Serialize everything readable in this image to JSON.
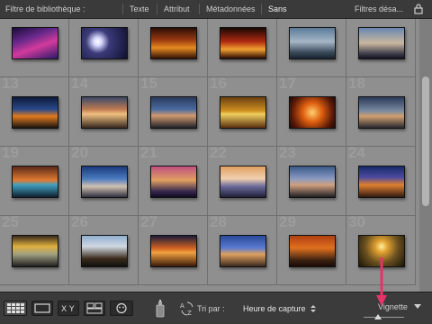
{
  "filter_bar": {
    "title": "Filtre de bibliothèque :",
    "tabs": [
      "Texte",
      "Attribut",
      "Métadonnées",
      "Sans"
    ],
    "active_tab": "Sans",
    "preset_label": "Filtres désa..."
  },
  "grid": {
    "numbers": [
      "",
      "",
      "",
      "",
      "",
      "",
      "13",
      "14",
      "15",
      "16",
      "17",
      "18",
      "19",
      "20",
      "21",
      "22",
      "23",
      "24",
      "25",
      "26",
      "27",
      "28",
      "29",
      "30"
    ],
    "thumbs": [
      {
        "gradient": "linear-gradient(160deg,#1a0b3a 0%,#6a2a8c 35%,#d23a9c 60%,#2a1a6a 100%)"
      },
      {
        "gradient": "radial-gradient(circle at 35% 45%,#ffffff 0%,#d8d8ff 12%,#3b3b7a 35%,#101030 100%)"
      },
      {
        "gradient": "linear-gradient(180deg,#2a0e06 0%,#9c3a10 40%,#e68a20 65%,#301005 100%)"
      },
      {
        "gradient": "linear-gradient(180deg,#1a0805 0%,#b02a10 45%,#f0a030 70%,#2a0a05 100%)"
      },
      {
        "gradient": "linear-gradient(180deg,#5a7a9a 0%,#a6b6c6 45%,#3a4a5a 80%,#1a2430 100%)"
      },
      {
        "gradient": "linear-gradient(180deg,#6a86b0 0%,#c9b8a0 50%,#3a3a48 85%,#141420 100%)"
      },
      {
        "gradient": "linear-gradient(180deg,#0d1a3a 0%,#2a4a8a 40%,#e07a20 62%,#1a1410 100%)"
      },
      {
        "gradient": "linear-gradient(180deg,#3a4a6a 0%,#c07a50 40%,#f0c080 55%,#3a2a20 100%)"
      },
      {
        "gradient": "linear-gradient(180deg,#2a3a5a 0%,#4a6aa0 40%,#d09a70 60%,#22222a 100%)"
      },
      {
        "gradient": "linear-gradient(180deg,#6a4010 0%,#d09020 45%,#f0d060 55%,#5a3010 100%)"
      },
      {
        "gradient": "radial-gradient(circle at 50% 50%,#ffd070 0%,#e06010 35%,#5a1a08 75%,#200805 100%)"
      },
      {
        "gradient": "linear-gradient(180deg,#2a3a5a 0%,#7a8aa0 45%,#d0a070 62%,#2a2a30 100%)"
      },
      {
        "gradient": "linear-gradient(180deg,#5a2a1a 0%,#e07a30 45%,#40a0c0 60%,#102030 100%)"
      },
      {
        "gradient": "linear-gradient(180deg,#1a3a7a 0%,#4a7ac0 40%,#d0c0b0 65%,#303040 100%)"
      },
      {
        "gradient": "linear-gradient(180deg,#c05080 0%,#e0a060 45%,#3a2a50 80%,#100a20 100%)"
      },
      {
        "gradient": "linear-gradient(180deg,#e0a060 0%,#f0d0b0 40%,#6a6a9a 65%,#20203a 100%)"
      },
      {
        "gradient": "linear-gradient(180deg,#3a5a8a 0%,#8a9ac0 40%,#d0a080 60%,#202024 100%)"
      },
      {
        "gradient": "linear-gradient(180deg,#1a2a6a 0%,#4a4aa0 35%,#e08030 60%,#301a10 100%)"
      },
      {
        "gradient": "linear-gradient(180deg,#3a2a1a 0%,#e0b040 35%,#a0a080 60%,#202020 100%)"
      },
      {
        "gradient": "linear-gradient(180deg,#90b0d0 0%,#d0d8e0 35%,#3a2a1a 75%,#101010 100%)"
      },
      {
        "gradient": "linear-gradient(180deg,#1a1a3a 0%,#d06020 40%,#f0a040 55%,#3a1a0a 100%)"
      },
      {
        "gradient": "linear-gradient(180deg,#2a4a9a 0%,#5a7ad0 40%,#e0a060 60%,#3a2a20 100%)"
      },
      {
        "gradient": "linear-gradient(180deg,#b04010 0%,#e07020 40%,#3a2010 80%,#1a0a05 100%)"
      },
      {
        "gradient": "radial-gradient(circle at 50% 35%,#fff0a0 0%,#e0a030 20%,#6a5020 55%,#1a1408 100%)"
      }
    ]
  },
  "toolbar": {
    "sort_label": "Tri par :",
    "sort_value": "Heure de capture",
    "thumbnail_label": "Vignette",
    "thumbnail_size": 0.35
  },
  "colors": {
    "annotation_arrow": "#e8336a",
    "panel_dark": "#3a3a3a",
    "grid_bg": "#8d8d8d"
  },
  "icons": [
    "lock-icon",
    "grid-view-icon",
    "loupe-view-icon",
    "compare-view-icon",
    "survey-view-icon",
    "people-view-icon",
    "spray-can-icon",
    "sort-direction-icon",
    "menu-arrow-icon"
  ]
}
